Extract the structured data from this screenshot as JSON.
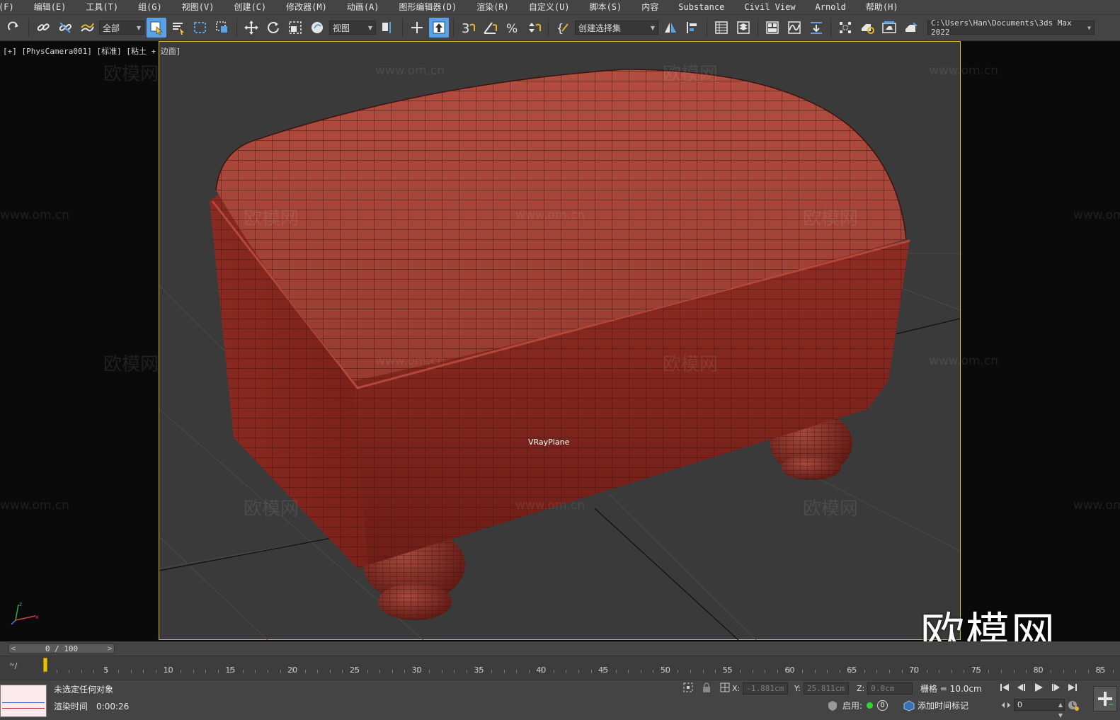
{
  "menu": {
    "items": [
      "(F)",
      "编辑(E)",
      "工具(T)",
      "组(G)",
      "视图(V)",
      "创建(C)",
      "修改器(M)",
      "动画(A)",
      "图形编辑器(D)",
      "渲染(R)",
      "自定义(U)",
      "脚本(S)",
      "内容",
      "Substance",
      "Civil View",
      "Arnold",
      "帮助(H)"
    ]
  },
  "toolbar": {
    "selection_filter": "全部",
    "ref_coord": "视图",
    "named_selection": "创建选择集",
    "project_path": "C:\\Users\\Han\\Documents\\3ds Max 2022"
  },
  "viewport": {
    "label": "[+] [PhysCamera001] [标准] [粘土 + 边面]",
    "object_label": "VRayPlane",
    "watermark_text": "欧模网",
    "watermark_url": "www.om.cn",
    "logo_text": "欧模网"
  },
  "timeline": {
    "slider_text": "0 / 100",
    "ticks": [
      "5",
      "10",
      "15",
      "20",
      "25",
      "30",
      "35",
      "40",
      "45",
      "50",
      "55",
      "60",
      "65",
      "70",
      "75",
      "80",
      "85"
    ]
  },
  "status": {
    "message": "未选定任何对象",
    "render_time_label": "渲染时间",
    "render_time_value": "0:00:26",
    "x_label": "X:",
    "x_value": "-1.881cm",
    "y_label": "Y:",
    "y_value": "25.811cm",
    "z_label": "Z:",
    "z_value": "0.0cm",
    "grid": "栅格 = 10.0cm",
    "enable_label": "启用:",
    "enable_count": "0",
    "add_time_tag": "添加时间标记",
    "current_frame": "0"
  },
  "colors": {
    "accent": "#5aa1e6",
    "safe_frame": "#d7c12a",
    "model": "#8c2a22",
    "time_cursor": "#e8c200"
  }
}
